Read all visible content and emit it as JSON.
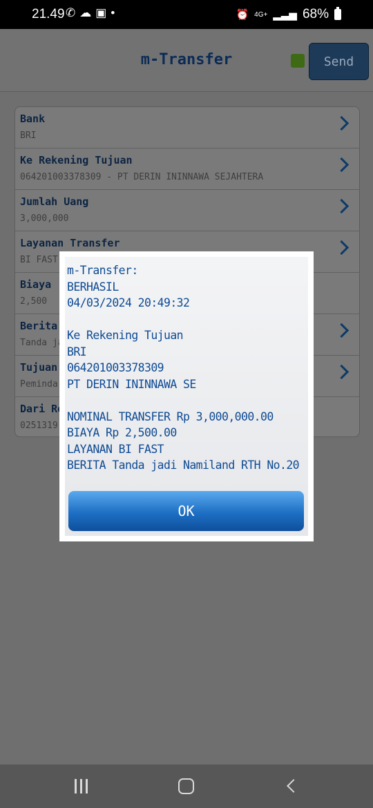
{
  "status_bar": {
    "time": "21.49",
    "left_icons": [
      "whatsapp-icon",
      "cloud-icon",
      "shopee-icon",
      "dot-icon"
    ],
    "network": "4G+",
    "battery": "68%"
  },
  "header": {
    "title": "m-Transfer",
    "send_label": "Send",
    "status_color": "#3e6a16"
  },
  "form": {
    "rows": [
      {
        "label": "Bank",
        "value": "BRI",
        "chevron": true
      },
      {
        "label": "Ke Rekening Tujuan",
        "value": "064201003378309 - PT DERIN ININNAWA SEJAHTERA",
        "chevron": true
      },
      {
        "label": "Jumlah Uang",
        "value": "3,000,000",
        "chevron": true
      },
      {
        "label": "Layanan Transfer",
        "value": "BI FAST",
        "chevron": true
      },
      {
        "label": "Biaya",
        "value": "2,500",
        "chevron": false
      },
      {
        "label": "Berita",
        "value": "Tanda ja",
        "chevron": true
      },
      {
        "label": "Tujuan T",
        "value": "Peminda",
        "chevron": true
      },
      {
        "label": "Dari Rek",
        "value": "0251319",
        "chevron": false
      }
    ]
  },
  "dialog": {
    "lines": [
      "m-Transfer:",
      "BERHASIL",
      "04/03/2024 20:49:32",
      "",
      "Ke Rekening Tujuan",
      "BRI",
      "064201003378309",
      "PT DERIN ININNAWA SE",
      "",
      "NOMINAL TRANSFER Rp 3,000,000.00",
      "BIAYA Rp 2,500.00",
      "LAYANAN BI FAST",
      "BERITA Tanda jadi Namiland RTH No.20"
    ],
    "ok_label": "OK"
  },
  "nav": {
    "recent": "recent-apps-icon",
    "home": "home-icon",
    "back": "back-icon"
  }
}
